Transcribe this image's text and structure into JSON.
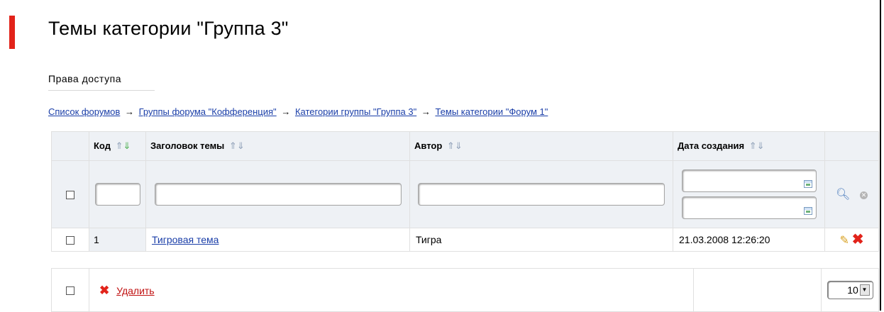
{
  "page": {
    "title": "Темы категории \"Группа 3\""
  },
  "tabs": {
    "access_rights": "Права доступа"
  },
  "breadcrumb": {
    "items": [
      "Список форумов",
      "Группы форума \"Кофференция\"",
      "Категории группы \"Группа 3\"",
      "Темы категории \"Форум 1\""
    ],
    "separator": "→"
  },
  "table": {
    "columns": {
      "code": "Код",
      "title": "Заголовок темы",
      "author": "Автор",
      "created": "Дата создания"
    },
    "sort_icons": {
      "up": "⇑",
      "down": "⇓"
    },
    "filters": {
      "code": "",
      "title": "",
      "author": "",
      "date_from": "",
      "date_to": ""
    },
    "rows": [
      {
        "code": "1",
        "title": "Тигровая тема",
        "author": "Тигра",
        "created": "21.03.2008 12:26:20"
      }
    ]
  },
  "footer": {
    "delete_label": "Удалить",
    "page_size": "10"
  },
  "icons": {
    "search": "search-icon",
    "cancel": "cancel-icon",
    "edit": "pencil-icon",
    "delete": "delete-icon",
    "calendar": "calendar-icon"
  },
  "colors": {
    "accent_red": "#e2231a",
    "link_blue": "#1a3ea8",
    "header_bg": "#eef1f5"
  }
}
